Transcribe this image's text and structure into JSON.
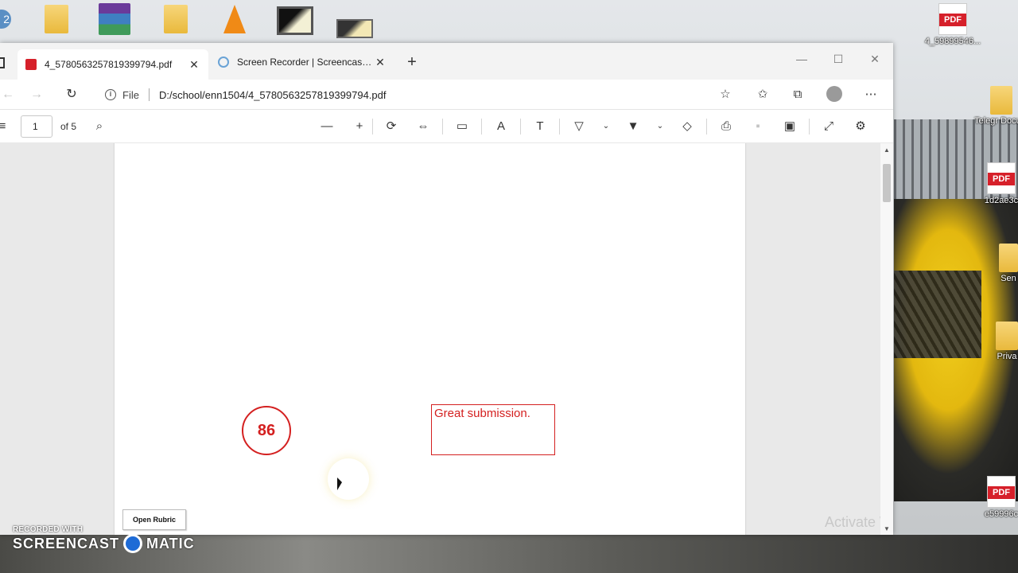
{
  "desktop": {
    "right_icons": [
      {
        "label": "4_59899546..."
      },
      {
        "label": "Telegr Docum"
      },
      {
        "label": "1d2ae3c"
      },
      {
        "label": "Sen"
      },
      {
        "label": "Priva"
      },
      {
        "label": "e59996c"
      }
    ],
    "pdf_badge": "PDF",
    "left_badge": "2"
  },
  "browser": {
    "tabs": [
      {
        "title": "4_5780563257819399794.pdf",
        "close": "✕"
      },
      {
        "title": "Screen Recorder | Screencast-O-Matic",
        "close": "✕"
      }
    ],
    "new_tab": "+",
    "window_controls": {
      "minimize": "—",
      "maximize": "☐",
      "close": "✕"
    },
    "address": {
      "scheme": "File",
      "url": "D:/school/enn1504/4_5780563257819399794.pdf"
    }
  },
  "pdf_toolbar": {
    "page_number": "1",
    "page_total": "of 5"
  },
  "document": {
    "grade": "86",
    "comment": "Great submission.",
    "rubric_button": "Open Rubric",
    "watermark_text": "Activate W"
  },
  "recording": {
    "caption": "RECORDED WITH",
    "brand_left": "SCREENCAST",
    "brand_right": "MATIC"
  },
  "colors": {
    "annotation_red": "#d42020",
    "pdf_red": "#d6202a"
  }
}
